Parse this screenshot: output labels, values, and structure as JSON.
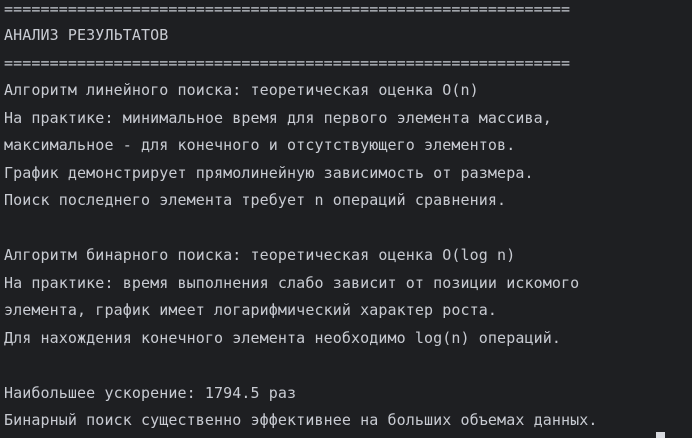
{
  "terminal": {
    "separator_top": "==============================================================",
    "heading": "АНАЛИЗ РЕЗУЛЬТАТОВ",
    "separator_bottom": "==============================================================",
    "linear": {
      "line1": "Алгоритм линейного поиска: теоретическая оценка O(n)",
      "line2": "На практике: минимальное время для первого элемента массива,",
      "line3": "максимальное - для конечного и отсутствующего элементов.",
      "line4": "График демонстрирует прямолинейную зависимость от размера.",
      "line5": "Поиск последнего элемента требует n операций сравнения."
    },
    "binary": {
      "line1": "Алгоритм бинарного поиска: теоретическая оценка O(log n)",
      "line2": "На практике: время выполнения слабо зависит от позиции искомого",
      "line3": "элемента, график имеет логарифмический характер роста.",
      "line4": "Для нахождения конечного элемента необходимо log(n) операций."
    },
    "speedup": {
      "line1": "Наибольшее ускорение: 1794.5 раз",
      "line2": "Бинарный поиск существенно эффективнее на больших объемах данных."
    }
  }
}
